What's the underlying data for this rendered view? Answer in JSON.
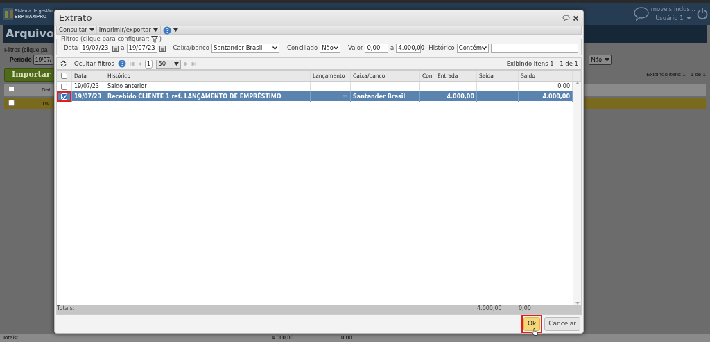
{
  "app": {
    "logo_line1": "Sistema de gestão",
    "logo_line2": "ERP MAXIPRO",
    "company": "moveis indus...",
    "user": "Usuário 1"
  },
  "page": {
    "title": "Arquivo",
    "filters_legend": "Filtros (clique pa",
    "period_label": "Período",
    "period_from": "19/07/",
    "conciliado": "Não",
    "import_button": "Importar",
    "paging": "Exibindo itens 1 - 1 de 1",
    "select_all_checked": false,
    "column": "Dat",
    "row_checked": false,
    "row_date": "19/",
    "totals_label": "Totais:",
    "totals": [
      "4.000,00",
      "0,00"
    ]
  },
  "dialog": {
    "title": "Extrato",
    "select_all_checked": false,
    "menu": [
      {
        "label": "Consultar"
      },
      {
        "label": "Imprimir/exportar"
      }
    ],
    "filters": {
      "legend_start": "Filtros (clique para configurar:",
      "legend_end": ")",
      "date_label": "Data",
      "date_from": "19/07/23",
      "date_sep": "a",
      "date_to": "19/07/23",
      "caixa_label": "Caixa/banco",
      "caixa": "Santander Brasil",
      "conciliado_label": "Conciliado",
      "conciliado": "Não",
      "valor_label": "Valor",
      "valor_from": "0,00",
      "valor_sep": "a",
      "valor_to": "4.000,00",
      "historico_label": "Histórico",
      "historico_mode": "Contém"
    },
    "grid_toolbar": {
      "hide_filters": "Ocultar filtros",
      "page": "1",
      "page_size": "50",
      "paging": "Exibindo itens 1 - 1 de 1"
    },
    "columns": [
      "Data",
      "Histórico",
      "Lançamento",
      "Caixa/banco",
      "Con",
      "Entrada",
      "Saída",
      "Saldo"
    ],
    "rows": [
      {
        "selected": false,
        "checked": false,
        "highlighted": false,
        "attachment": false,
        "cells": [
          "19/07/23",
          "Saldo anterior",
          null,
          null,
          null,
          null,
          null,
          "0,00"
        ]
      },
      {
        "selected": true,
        "checked": true,
        "highlighted": true,
        "attachment": true,
        "cells": [
          "19/07/23",
          "Recebido CLIENTE 1 ref. LANÇAMENTO DE EMPRÉSTIMO",
          null,
          "Santander Brasil",
          null,
          "4.000,00",
          null,
          "4.000,00"
        ]
      }
    ],
    "totals": {
      "label": "Totais:",
      "entrada": "4.000,00",
      "saida": "0,00"
    },
    "buttons": [
      {
        "label": "Ok",
        "kind": "primary",
        "highlighted": true
      },
      {
        "label": "Cancelar",
        "kind": "secondary",
        "highlighted": false
      }
    ]
  }
}
